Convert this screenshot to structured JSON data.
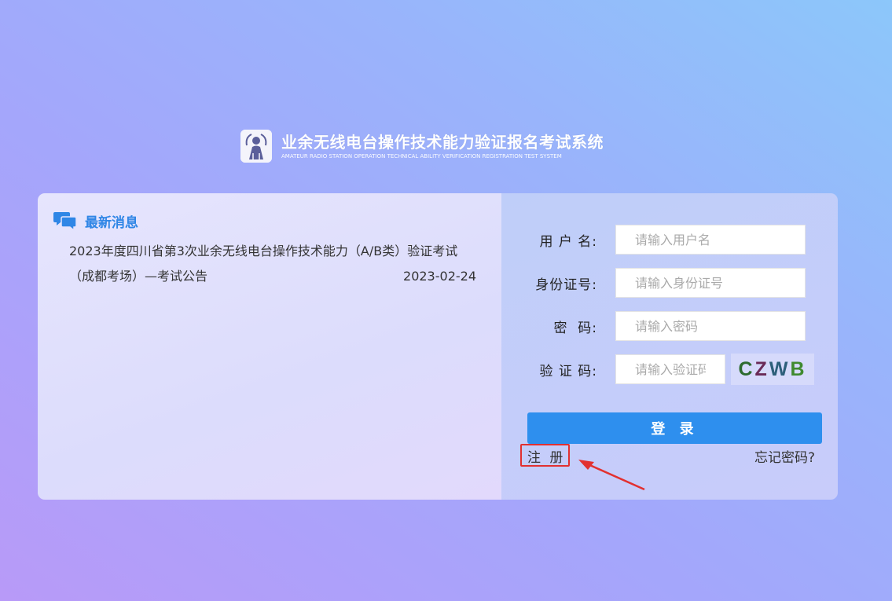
{
  "header": {
    "title": "业余无线电台操作技术能力验证报名考试系统",
    "subtitle": "AMATEUR RADIO STATION OPERATION TECHNICAL ABILITY VERIFICATION REGISTRATION TEST SYSTEM",
    "logo_icon": "radio-operator-logo"
  },
  "news": {
    "heading": "最新消息",
    "icon": "chat-bubbles-icon",
    "items": [
      {
        "title": "2023年度四川省第3次业余无线电台操作技术能力（A/B类）验证考试（成都考场）—考试公告",
        "date": "2023-02-24"
      }
    ]
  },
  "login": {
    "username_label": "用 户 名:",
    "username_placeholder": "请输入用户名",
    "idcard_label": "身份证号:",
    "idcard_placeholder": "请输入身份证号",
    "password_label": "密  码:",
    "password_placeholder": "请输入密码",
    "captcha_label": "验 证 码:",
    "captcha_placeholder": "请输入验证码",
    "captcha": [
      {
        "char": "C",
        "color": "#2d6b2f"
      },
      {
        "char": "Z",
        "color": "#6a2a57"
      },
      {
        "char": " ",
        "color": "#000000"
      },
      {
        "char": "W",
        "color": "#2d5f7a"
      },
      {
        "char": "B",
        "color": "#3f8a2f"
      }
    ],
    "login_button": "登 录",
    "register_link": "注 册",
    "forgot_link": "忘记密码?"
  },
  "colors": {
    "accent": "#2e8fee",
    "heading": "#2f86e6",
    "annotation": "#e23030"
  }
}
